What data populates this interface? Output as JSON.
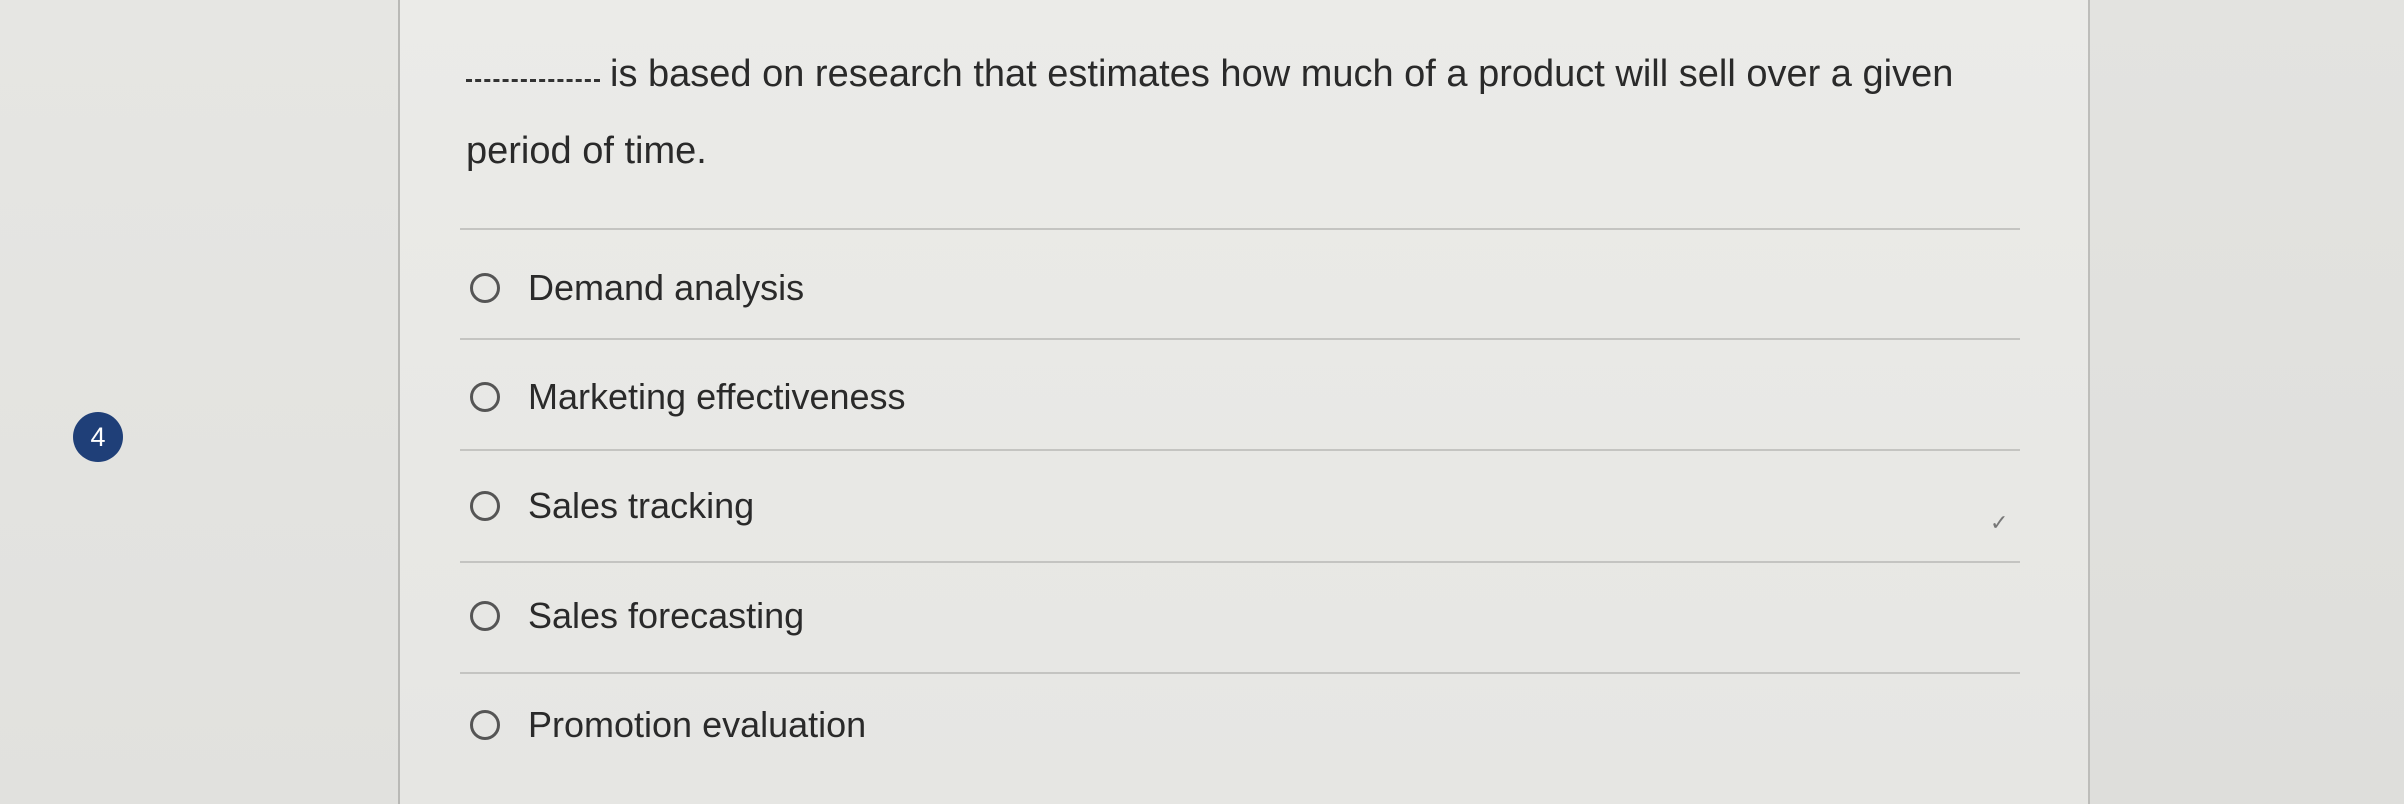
{
  "question": {
    "number": "4",
    "text": "is based on research that estimates how much of a product will sell over a given period of time."
  },
  "options": [
    {
      "label": "Demand analysis"
    },
    {
      "label": "Marketing effectiveness"
    },
    {
      "label": "Sales tracking"
    },
    {
      "label": "Sales forecasting"
    },
    {
      "label": "Promotion evaluation"
    }
  ],
  "colors": {
    "badge": "#1f3f78",
    "background": "#e8e8e5"
  },
  "icons": {
    "checkmark": "✓"
  }
}
